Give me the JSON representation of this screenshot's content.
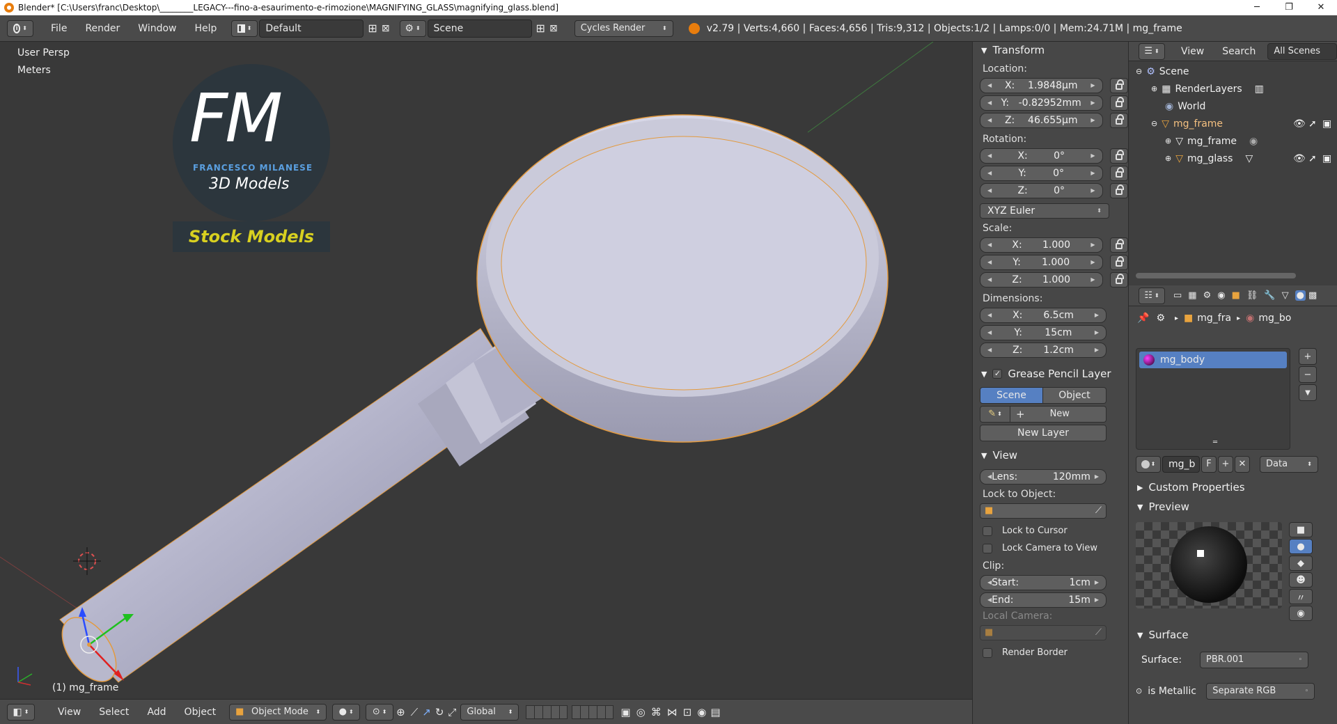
{
  "window": {
    "title": "Blender* [C:\\Users\\franc\\Desktop\\________LEGACY---fino-a-esaurimento-e-rimozione\\MAGNIFYING_GLASS\\magnifying_glass.blend]",
    "min": "─",
    "max": "❐",
    "close": "✕"
  },
  "infobar": {
    "menus": [
      "File",
      "Render",
      "Window",
      "Help"
    ],
    "screen": "Default",
    "scene": "Scene",
    "engine": "Cycles Render",
    "stats": "v2.79 | Verts:4,660 | Faces:4,656 | Tris:9,312 | Objects:1/2 | Lamps:0/0 | Mem:24.71M | mg_frame"
  },
  "viewport": {
    "view_name": "User Persp",
    "units": "Meters",
    "selected": "(1) mg_frame",
    "logo": {
      "letters": "FM",
      "name": "FRANCESCO MILANESE",
      "sub": "3D Models",
      "badge": "Stock Models"
    }
  },
  "header3d": {
    "menus": [
      "View",
      "Select",
      "Add",
      "Object"
    ],
    "mode": "Object Mode",
    "orientation": "Global"
  },
  "npanel": {
    "transform_title": "Transform",
    "location_label": "Location:",
    "location": [
      {
        "axis": "X:",
        "value": "1.9848µm"
      },
      {
        "axis": "Y:",
        "value": "-0.82952mm"
      },
      {
        "axis": "Z:",
        "value": "46.655µm"
      }
    ],
    "rotation_label": "Rotation:",
    "rotation": [
      {
        "axis": "X:",
        "value": "0°"
      },
      {
        "axis": "Y:",
        "value": "0°"
      },
      {
        "axis": "Z:",
        "value": "0°"
      }
    ],
    "rotation_mode": "XYZ Euler",
    "scale_label": "Scale:",
    "scale": [
      {
        "axis": "X:",
        "value": "1.000"
      },
      {
        "axis": "Y:",
        "value": "1.000"
      },
      {
        "axis": "Z:",
        "value": "1.000"
      }
    ],
    "dimensions_label": "Dimensions:",
    "dimensions": [
      {
        "axis": "X:",
        "value": "6.5cm"
      },
      {
        "axis": "Y:",
        "value": "15cm"
      },
      {
        "axis": "Z:",
        "value": "1.2cm"
      }
    ],
    "gp_title": "Grease Pencil Layer",
    "gp_scene": "Scene",
    "gp_object": "Object",
    "gp_new": "New",
    "gp_new_layer": "New Layer",
    "view_title": "View",
    "lens_label": "Lens:",
    "lens_value": "120mm",
    "lock_object_label": "Lock to Object:",
    "lock_cursor": "Lock to Cursor",
    "lock_camera": "Lock Camera to View",
    "clip_label": "Clip:",
    "clip_start_label": "Start:",
    "clip_start": "1cm",
    "clip_end_label": "End:",
    "clip_end": "15m",
    "local_camera_label": "Local Camera:",
    "render_border": "Render Border"
  },
  "outliner": {
    "menus": [
      "View",
      "Search"
    ],
    "filter": "All Scenes",
    "rows": [
      "Scene",
      "RenderLayers",
      "World",
      "mg_frame",
      "mg_frame",
      "mg_glass"
    ]
  },
  "properties": {
    "breadcrumb": [
      "mg_fra",
      "mg_bo"
    ],
    "material": "mg_body",
    "material_short": "mg_b",
    "fake_user": "F",
    "link": "Data",
    "custom_props": "Custom Properties",
    "preview": "Preview",
    "surface_title": "Surface",
    "surface_label": "Surface:",
    "surface_value": "PBR.001",
    "metallic_label": "is Metallic",
    "metallic_value": "Separate RGB"
  }
}
